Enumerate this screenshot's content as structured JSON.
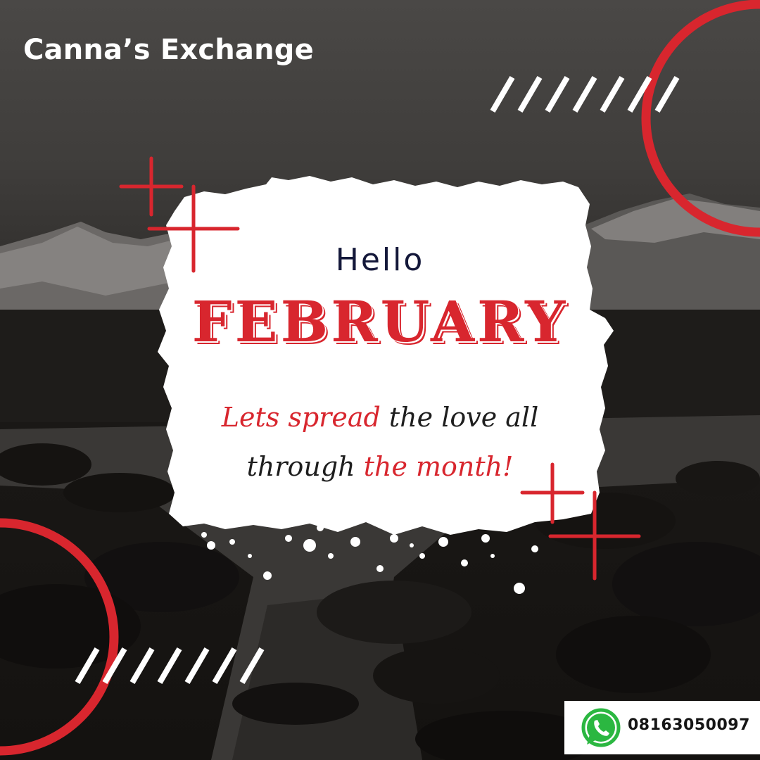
{
  "brand": {
    "name": "Canna’s Exchange"
  },
  "card": {
    "greeting": "Hello",
    "month": "FEBRUARY",
    "message_line1": {
      "red": "Lets spread",
      "dark": " the love all"
    },
    "message_line2": {
      "dark": "through ",
      "red": "the month!"
    }
  },
  "contact": {
    "phone": "08163050097",
    "icon": "whatsapp-icon"
  },
  "colors": {
    "accent_red": "#d8262e",
    "navy_text": "#14183a",
    "card_white": "#ffffff",
    "background_dark": "#2f2d2b"
  },
  "decor_icons": [
    "red-circle-outline",
    "diagonal-stripes",
    "sparkle-cross"
  ]
}
